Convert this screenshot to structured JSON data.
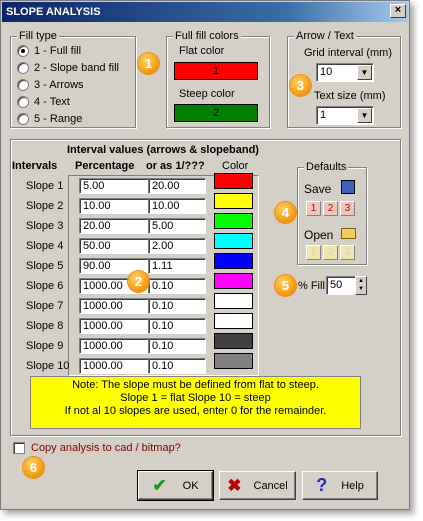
{
  "window": {
    "title": "SLOPE ANALYSIS",
    "close_glyph": "×"
  },
  "fill_type": {
    "title": "Fill type",
    "options": [
      "1 - Full fill",
      "2 - Slope band fill",
      "3 - Arrows",
      "4 - Text",
      "5 - Range"
    ],
    "selected_index": 0
  },
  "fill_colors": {
    "title": "Full fill colors",
    "flat_label": "Flat color",
    "flat_value": "1",
    "flat_color": "#ff0000",
    "steep_label": "Steep color",
    "steep_value": "2",
    "steep_color": "#008000"
  },
  "arrow_text": {
    "title": "Arrow / Text",
    "grid_label": "Grid interval  (mm)",
    "grid_value": "10",
    "size_label": "Text size    (mm)",
    "size_value": "1"
  },
  "intervals": {
    "title": "Interval values (arrows & slopeband)",
    "col_intervals": "Intervals",
    "col_percentage": "Percentage",
    "col_ratio": "or as 1/???",
    "col_color": "Color",
    "rows": [
      {
        "label": "Slope 1",
        "pct": "5.00",
        "ratio": "20.00",
        "color": "#ff0000"
      },
      {
        "label": "Slope 2",
        "pct": "10.00",
        "ratio": "10.00",
        "color": "#ffff00"
      },
      {
        "label": "Slope 3",
        "pct": "20.00",
        "ratio": "5.00",
        "color": "#00ff00"
      },
      {
        "label": "Slope 4",
        "pct": "50.00",
        "ratio": "2.00",
        "color": "#00ffff"
      },
      {
        "label": "Slope 5",
        "pct": "90.00",
        "ratio": "1.11",
        "color": "#0000ff"
      },
      {
        "label": "Slope 6",
        "pct": "1000.00",
        "ratio": "0.10",
        "color": "#ff00ff"
      },
      {
        "label": "Slope 7",
        "pct": "1000.00",
        "ratio": "0.10",
        "color": "#ffffff"
      },
      {
        "label": "Slope 8",
        "pct": "1000.00",
        "ratio": "0.10",
        "color": "#ffffff"
      },
      {
        "label": "Slope 9",
        "pct": "1000.00",
        "ratio": "0.10",
        "color": "#404040"
      },
      {
        "label": "Slope 10",
        "pct": "1000.00",
        "ratio": "0.10",
        "color": "#808080"
      }
    ]
  },
  "defaults": {
    "title": "Defaults",
    "save_label": "Save",
    "open_label": "Open",
    "slots": [
      "1",
      "2",
      "3"
    ]
  },
  "fill_percent": {
    "label": "% Fill",
    "value": "50"
  },
  "note": {
    "line1": "Note: The slope must be defined from flat to steep.",
    "line2": "Slope 1 = flat      Slope 10 = steep",
    "line3": "If not al 10 slopes are used, enter 0 for the remainder."
  },
  "copy_checkbox": {
    "label": "Copy analysis to cad / bitmap?",
    "checked": false
  },
  "buttons": {
    "ok": "OK",
    "cancel": "Cancel",
    "help": "Help"
  },
  "badges": [
    "1",
    "2",
    "3",
    "4",
    "5",
    "6"
  ]
}
